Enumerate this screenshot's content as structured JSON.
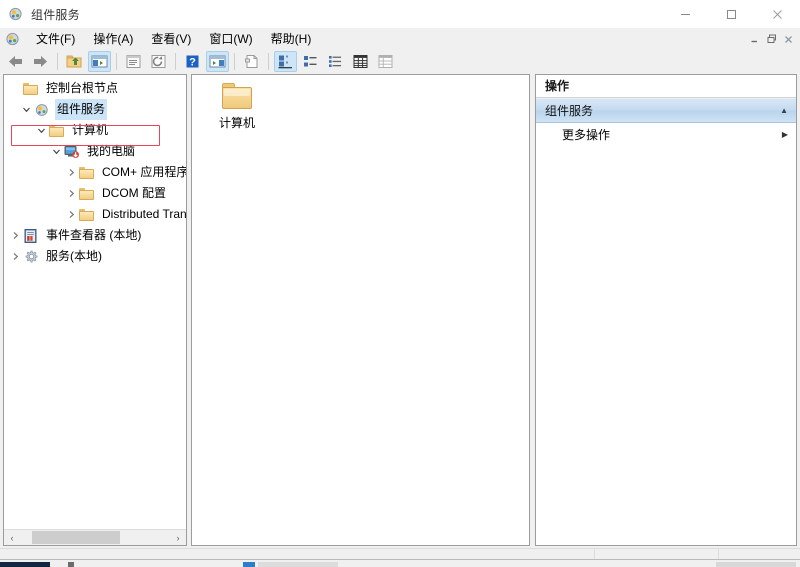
{
  "window": {
    "title": "组件服务",
    "icon": "component-services-icon",
    "buttons": {
      "minimize": "–",
      "maximize": "▢",
      "close": "✕"
    }
  },
  "menubar": {
    "icon": "component-services-icon",
    "items": [
      {
        "label": "文件(F)",
        "name": "menu-file"
      },
      {
        "label": "操作(A)",
        "name": "menu-action"
      },
      {
        "label": "查看(V)",
        "name": "menu-view"
      },
      {
        "label": "窗口(W)",
        "name": "menu-window"
      },
      {
        "label": "帮助(H)",
        "name": "menu-help"
      }
    ],
    "mdi_buttons": [
      {
        "name": "mdi-minimize-button",
        "glyph": "minimize"
      },
      {
        "name": "mdi-restore-button",
        "glyph": "restore"
      },
      {
        "name": "mdi-close-button",
        "glyph": "close"
      }
    ]
  },
  "toolbar": {
    "buttons": [
      {
        "name": "back-button",
        "icon": "back-arrow-icon",
        "pressed": false
      },
      {
        "name": "forward-button",
        "icon": "forward-arrow-icon",
        "pressed": false
      },
      {
        "name": "up-one-level-button",
        "icon": "up-folder-icon",
        "pressed": false
      },
      {
        "name": "show-hide-tree-button",
        "icon": "console-tree-icon",
        "pressed": true
      },
      {
        "name": "properties-button",
        "icon": "properties-icon",
        "pressed": false
      },
      {
        "name": "refresh-button",
        "icon": "refresh-icon",
        "pressed": false
      },
      {
        "name": "help-button",
        "icon": "help-question-icon",
        "pressed": false
      },
      {
        "name": "show-hide-action-pane-button",
        "icon": "action-pane-icon",
        "pressed": true
      },
      {
        "name": "export-list-button",
        "icon": "export-list-icon",
        "pressed": false
      },
      {
        "name": "view-large-icons-button",
        "icon": "large-icons-icon",
        "pressed": true
      },
      {
        "name": "view-small-icons-button",
        "icon": "small-icons-icon",
        "pressed": false
      },
      {
        "name": "view-list-button",
        "icon": "list-view-icon",
        "pressed": false
      },
      {
        "name": "view-detail-button",
        "icon": "detail-view-icon",
        "pressed": false
      },
      {
        "name": "view-report-button",
        "icon": "report-view-icon",
        "pressed": false
      }
    ]
  },
  "tree": {
    "nodes": [
      {
        "label": "控制台根节点",
        "icon": "folder-icon",
        "indent": 0,
        "expander": "none",
        "selected": false
      },
      {
        "label": "组件服务",
        "icon": "component-services-icon",
        "indent": 1,
        "expander": "expanded",
        "selected": true
      },
      {
        "label": "计算机",
        "icon": "folder-icon",
        "indent": 2,
        "expander": "expanded",
        "selected": false
      },
      {
        "label": "我的电脑",
        "icon": "my-computer-icon",
        "indent": 3,
        "expander": "expanded",
        "selected": false
      },
      {
        "label": "COM+ 应用程序",
        "icon": "folder-icon",
        "indent": 4,
        "expander": "collapsed",
        "selected": false
      },
      {
        "label": "DCOM 配置",
        "icon": "folder-icon",
        "indent": 4,
        "expander": "collapsed",
        "selected": false
      },
      {
        "label": "Distributed Trans",
        "icon": "folder-icon",
        "indent": 4,
        "expander": "collapsed",
        "selected": false
      },
      {
        "label": "事件查看器 (本地)",
        "icon": "event-viewer-icon",
        "indent": 1,
        "expander": "collapsed",
        "selected": false
      },
      {
        "label": "服务(本地)",
        "icon": "services-gear-icon",
        "indent": 1,
        "expander": "collapsed",
        "selected": false
      }
    ],
    "highlight": {
      "target": "我的电脑",
      "color": "#e8445a"
    },
    "scrollbar": {
      "left_arrow": "‹",
      "right_arrow": "›"
    }
  },
  "list": {
    "items": [
      {
        "label": "计算机",
        "icon": "folder-icon"
      }
    ]
  },
  "actions": {
    "title": "操作",
    "groups": [
      {
        "label": "组件服务",
        "collapse_glyph": "▲",
        "rows": [
          {
            "label": "更多操作",
            "submenu_glyph": "▶"
          }
        ]
      }
    ]
  },
  "colors": {
    "selection": "#cce4f7",
    "accent": "#2a7fc9",
    "highlight": "#e8445a",
    "panel_border": "#9c9c9c",
    "chrome": "#f0f0f0"
  }
}
